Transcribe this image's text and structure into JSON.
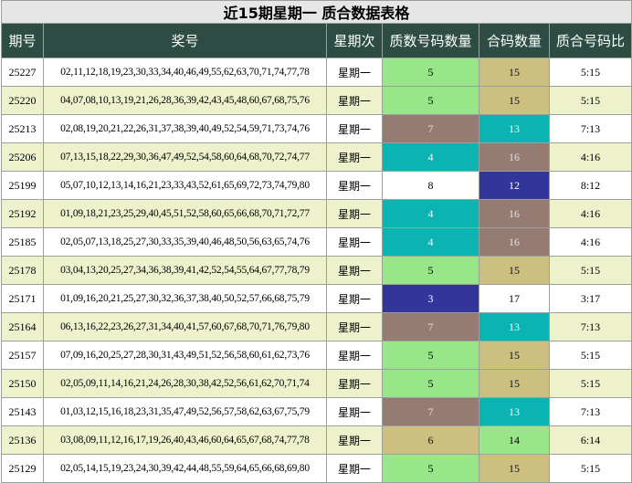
{
  "title": "近15期星期一 质合数据表格",
  "headers": [
    "期号",
    "奖号",
    "星期次",
    "质数号码数量",
    "合码数量",
    "质合号码比"
  ],
  "colors": {
    "green": "#99e68a",
    "tan": "#cdbf7f",
    "teal": "#0bb3b3",
    "mauve": "#957b72",
    "navy": "#32369a",
    "white": "#ffffff"
  },
  "rows": [
    {
      "issue": "25227",
      "numbers": "02,11,12,18,19,23,30,33,34,40,46,49,55,62,63,70,71,74,77,78",
      "weekday": "星期一",
      "prime": "5",
      "composite": "15",
      "ratio": "5:15",
      "prime_color": "green",
      "composite_color": "tan"
    },
    {
      "issue": "25220",
      "numbers": "04,07,08,10,13,19,21,26,28,36,39,42,43,45,48,60,67,68,75,76",
      "weekday": "星期一",
      "prime": "5",
      "composite": "15",
      "ratio": "5:15",
      "prime_color": "green",
      "composite_color": "tan"
    },
    {
      "issue": "25213",
      "numbers": "02,08,19,20,21,22,26,31,37,38,39,40,49,52,54,59,71,73,74,76",
      "weekday": "星期一",
      "prime": "7",
      "composite": "13",
      "ratio": "7:13",
      "prime_color": "mauve",
      "composite_color": "teal"
    },
    {
      "issue": "25206",
      "numbers": "07,13,15,18,22,29,30,36,47,49,52,54,58,60,64,68,70,72,74,77",
      "weekday": "星期一",
      "prime": "4",
      "composite": "16",
      "ratio": "4:16",
      "prime_color": "teal",
      "composite_color": "mauve"
    },
    {
      "issue": "25199",
      "numbers": "05,07,10,12,13,14,16,21,23,33,43,52,61,65,69,72,73,74,79,80",
      "weekday": "星期一",
      "prime": "8",
      "composite": "12",
      "ratio": "8:12",
      "prime_color": "white",
      "composite_color": "navy"
    },
    {
      "issue": "25192",
      "numbers": "01,09,18,21,23,25,29,40,45,51,52,58,60,65,66,68,70,71,72,77",
      "weekday": "星期一",
      "prime": "4",
      "composite": "16",
      "ratio": "4:16",
      "prime_color": "teal",
      "composite_color": "mauve"
    },
    {
      "issue": "25185",
      "numbers": "02,05,07,13,18,25,27,30,33,35,39,40,46,48,50,56,63,65,74,76",
      "weekday": "星期一",
      "prime": "4",
      "composite": "16",
      "ratio": "4:16",
      "prime_color": "teal",
      "composite_color": "mauve"
    },
    {
      "issue": "25178",
      "numbers": "03,04,13,20,25,27,34,36,38,39,41,42,52,54,55,64,67,77,78,79",
      "weekday": "星期一",
      "prime": "5",
      "composite": "15",
      "ratio": "5:15",
      "prime_color": "green",
      "composite_color": "tan"
    },
    {
      "issue": "25171",
      "numbers": "01,09,16,20,21,25,27,30,32,36,37,38,40,50,52,57,66,68,75,79",
      "weekday": "星期一",
      "prime": "3",
      "composite": "17",
      "ratio": "3:17",
      "prime_color": "navy",
      "composite_color": "white"
    },
    {
      "issue": "25164",
      "numbers": "06,13,16,22,23,26,27,31,34,40,41,57,60,67,68,70,71,76,79,80",
      "weekday": "星期一",
      "prime": "7",
      "composite": "13",
      "ratio": "7:13",
      "prime_color": "mauve",
      "composite_color": "teal"
    },
    {
      "issue": "25157",
      "numbers": "07,09,16,20,25,27,28,30,31,43,49,51,52,56,58,60,61,62,73,76",
      "weekday": "星期一",
      "prime": "5",
      "composite": "15",
      "ratio": "5:15",
      "prime_color": "green",
      "composite_color": "tan"
    },
    {
      "issue": "25150",
      "numbers": "02,05,09,11,14,16,21,24,26,28,30,38,42,52,56,61,62,70,71,74",
      "weekday": "星期一",
      "prime": "5",
      "composite": "15",
      "ratio": "5:15",
      "prime_color": "green",
      "composite_color": "tan"
    },
    {
      "issue": "25143",
      "numbers": "01,03,12,15,16,18,23,31,35,47,49,52,56,57,58,62,63,67,75,79",
      "weekday": "星期一",
      "prime": "7",
      "composite": "13",
      "ratio": "7:13",
      "prime_color": "mauve",
      "composite_color": "teal"
    },
    {
      "issue": "25136",
      "numbers": "03,08,09,11,12,16,17,19,26,40,43,46,60,64,65,67,68,74,77,78",
      "weekday": "星期一",
      "prime": "6",
      "composite": "14",
      "ratio": "6:14",
      "prime_color": "tan",
      "composite_color": "green"
    },
    {
      "issue": "25129",
      "numbers": "02,05,14,15,19,23,24,30,39,42,44,48,55,59,64,65,66,68,69,80",
      "weekday": "星期一",
      "prime": "5",
      "composite": "15",
      "ratio": "5:15",
      "prime_color": "green",
      "composite_color": "tan"
    }
  ]
}
